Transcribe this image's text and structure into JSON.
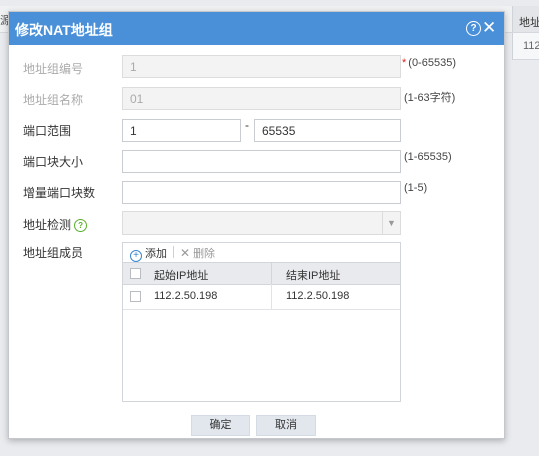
{
  "background": {
    "left_fragment": "源",
    "right_header": "地址",
    "right_cell": "112"
  },
  "dialog": {
    "title": "修改NAT地址组",
    "help_icon": "question-circle",
    "close_icon": "close-x"
  },
  "form": {
    "group_id": {
      "label": "地址组编号",
      "value": "1",
      "required_mark": "*",
      "hint": "(0-65535)",
      "disabled": true
    },
    "group_name": {
      "label": "地址组名称",
      "value": "01",
      "hint": "(1-63字符)",
      "disabled": true
    },
    "port_range": {
      "label": "端口范围",
      "start": "1",
      "separator": "-",
      "end": "65535"
    },
    "port_block_size": {
      "label": "端口块大小",
      "value": "",
      "hint": "(1-65535)"
    },
    "incremental_blocks": {
      "label": "增量端口块数",
      "value": "",
      "hint": "(1-5)"
    },
    "address_detection": {
      "label": "地址检测",
      "value": "",
      "help_icon": "question-circle-green"
    },
    "members": {
      "label": "地址组成员",
      "add_label": "添加",
      "delete_label": "删除",
      "columns": [
        "起始IP地址",
        "结束IP地址"
      ],
      "rows": [
        {
          "start_ip": "112.2.50.198",
          "end_ip": "112.2.50.198"
        }
      ]
    }
  },
  "buttons": {
    "confirm": "确定",
    "cancel": "取消"
  },
  "colors": {
    "titlebar": "#4a90d9",
    "required": "#e02020",
    "help_green": "#58b12c"
  }
}
